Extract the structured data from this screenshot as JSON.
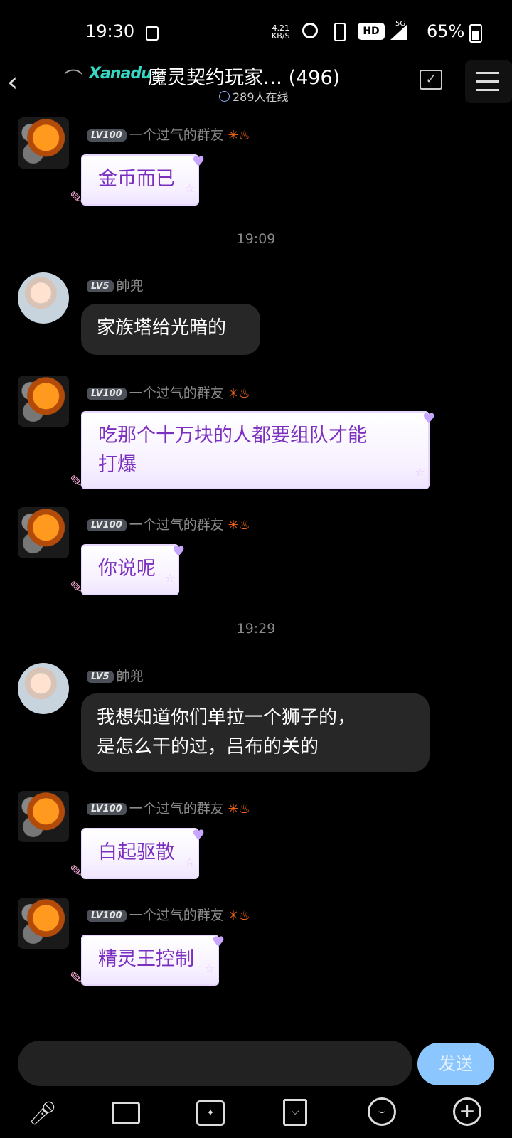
{
  "status": {
    "time": "19:30",
    "speed_top": "4.21",
    "speed_bottom": "KB/S",
    "hd": "HD",
    "net": "5G",
    "battery": "65%"
  },
  "header": {
    "back_icon": "chevron-left-icon",
    "logo_text": "Xanadu",
    "title": "魔灵契约玩家… (496)",
    "online": "289人在线"
  },
  "messages": [
    {
      "level": "LV100",
      "name": "一个过气的群友",
      "text": "金币而已"
    },
    {
      "time": "19:09"
    },
    {
      "level": "LV5",
      "name": "帥兜",
      "text": "家族塔给光暗的"
    },
    {
      "level": "LV100",
      "name": "一个过气的群友",
      "text_line1": "吃那个十万块的人都要组队才能",
      "text_line2": "打爆"
    },
    {
      "level": "LV100",
      "name": "一个过气的群友",
      "text": "你说呢"
    },
    {
      "time": "19:29"
    },
    {
      "level": "LV5",
      "name": "帥兜",
      "text_line1": "我想知道你们单拉一个狮子的，",
      "text_line2": "是怎么干的过，吕布的关的"
    },
    {
      "level": "LV100",
      "name": "一个过气的群友",
      "text": "白起驱散"
    },
    {
      "level": "LV100",
      "name": "一个过气的群友",
      "text": "精灵王控制"
    }
  ],
  "input": {
    "send_label": "发送"
  },
  "colors": {
    "accent_send": "#8cc6ff",
    "fancy_text": "#7b2fc0",
    "dark_bubble": "#272727"
  }
}
